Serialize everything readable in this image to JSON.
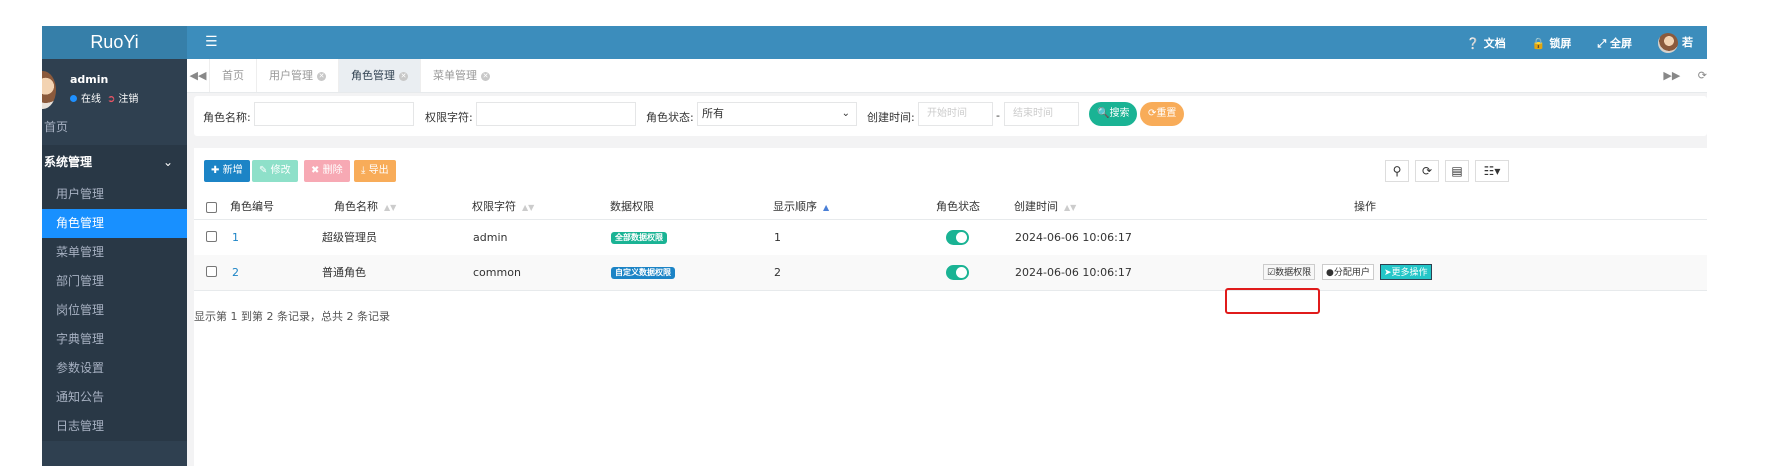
{
  "app": {
    "logo": "RuoYi"
  },
  "user": {
    "name": "admin",
    "status": "在线",
    "logout": "注销"
  },
  "sidebar": {
    "home": "首页",
    "group": "系统管理",
    "items": [
      "用户管理",
      "角色管理",
      "菜单管理",
      "部门管理",
      "岗位管理",
      "字典管理",
      "参数设置",
      "通知公告",
      "日志管理"
    ]
  },
  "topbar": {
    "docs": "文档",
    "lock": "锁屏",
    "fullscreen": "全屏",
    "user": "若"
  },
  "tabs": [
    "首页",
    "用户管理",
    "角色管理",
    "菜单管理"
  ],
  "search": {
    "role_name_label": "角色名称:",
    "perm_label": "权限字符:",
    "status_label": "角色状态:",
    "status_value": "所有",
    "created_label": "创建时间:",
    "start_placeholder": "开始时间",
    "end_placeholder": "结束时间",
    "search_btn": "搜索",
    "reset_btn": "重置"
  },
  "toolbar": {
    "add": "新增",
    "edit": "修改",
    "delete": "删除",
    "export": "导出"
  },
  "table": {
    "headers": [
      "角色编号",
      "角色名称",
      "权限字符",
      "数据权限",
      "显示顺序",
      "角色状态",
      "创建时间",
      "操作"
    ],
    "rows": [
      {
        "id": "1",
        "name": "超级管理员",
        "key": "admin",
        "scope": "全部数据权限",
        "order": "1",
        "created": "2024-06-06 10:06:17"
      },
      {
        "id": "2",
        "name": "普通角色",
        "key": "common",
        "scope": "自定义数据权限",
        "order": "2",
        "created": "2024-06-06 10:06:17"
      }
    ],
    "ops": {
      "data_scope": "数据权限",
      "assign_user": "分配用户",
      "more": "更多操作"
    },
    "footer": "显示第 1 到第 2 条记录，总共 2 条记录"
  },
  "colors": {
    "sidebar": "#2f4050",
    "topbar": "#3c8dbc",
    "active": "#1890ff",
    "primary": "#1ab394",
    "warning": "#f8ac59"
  }
}
